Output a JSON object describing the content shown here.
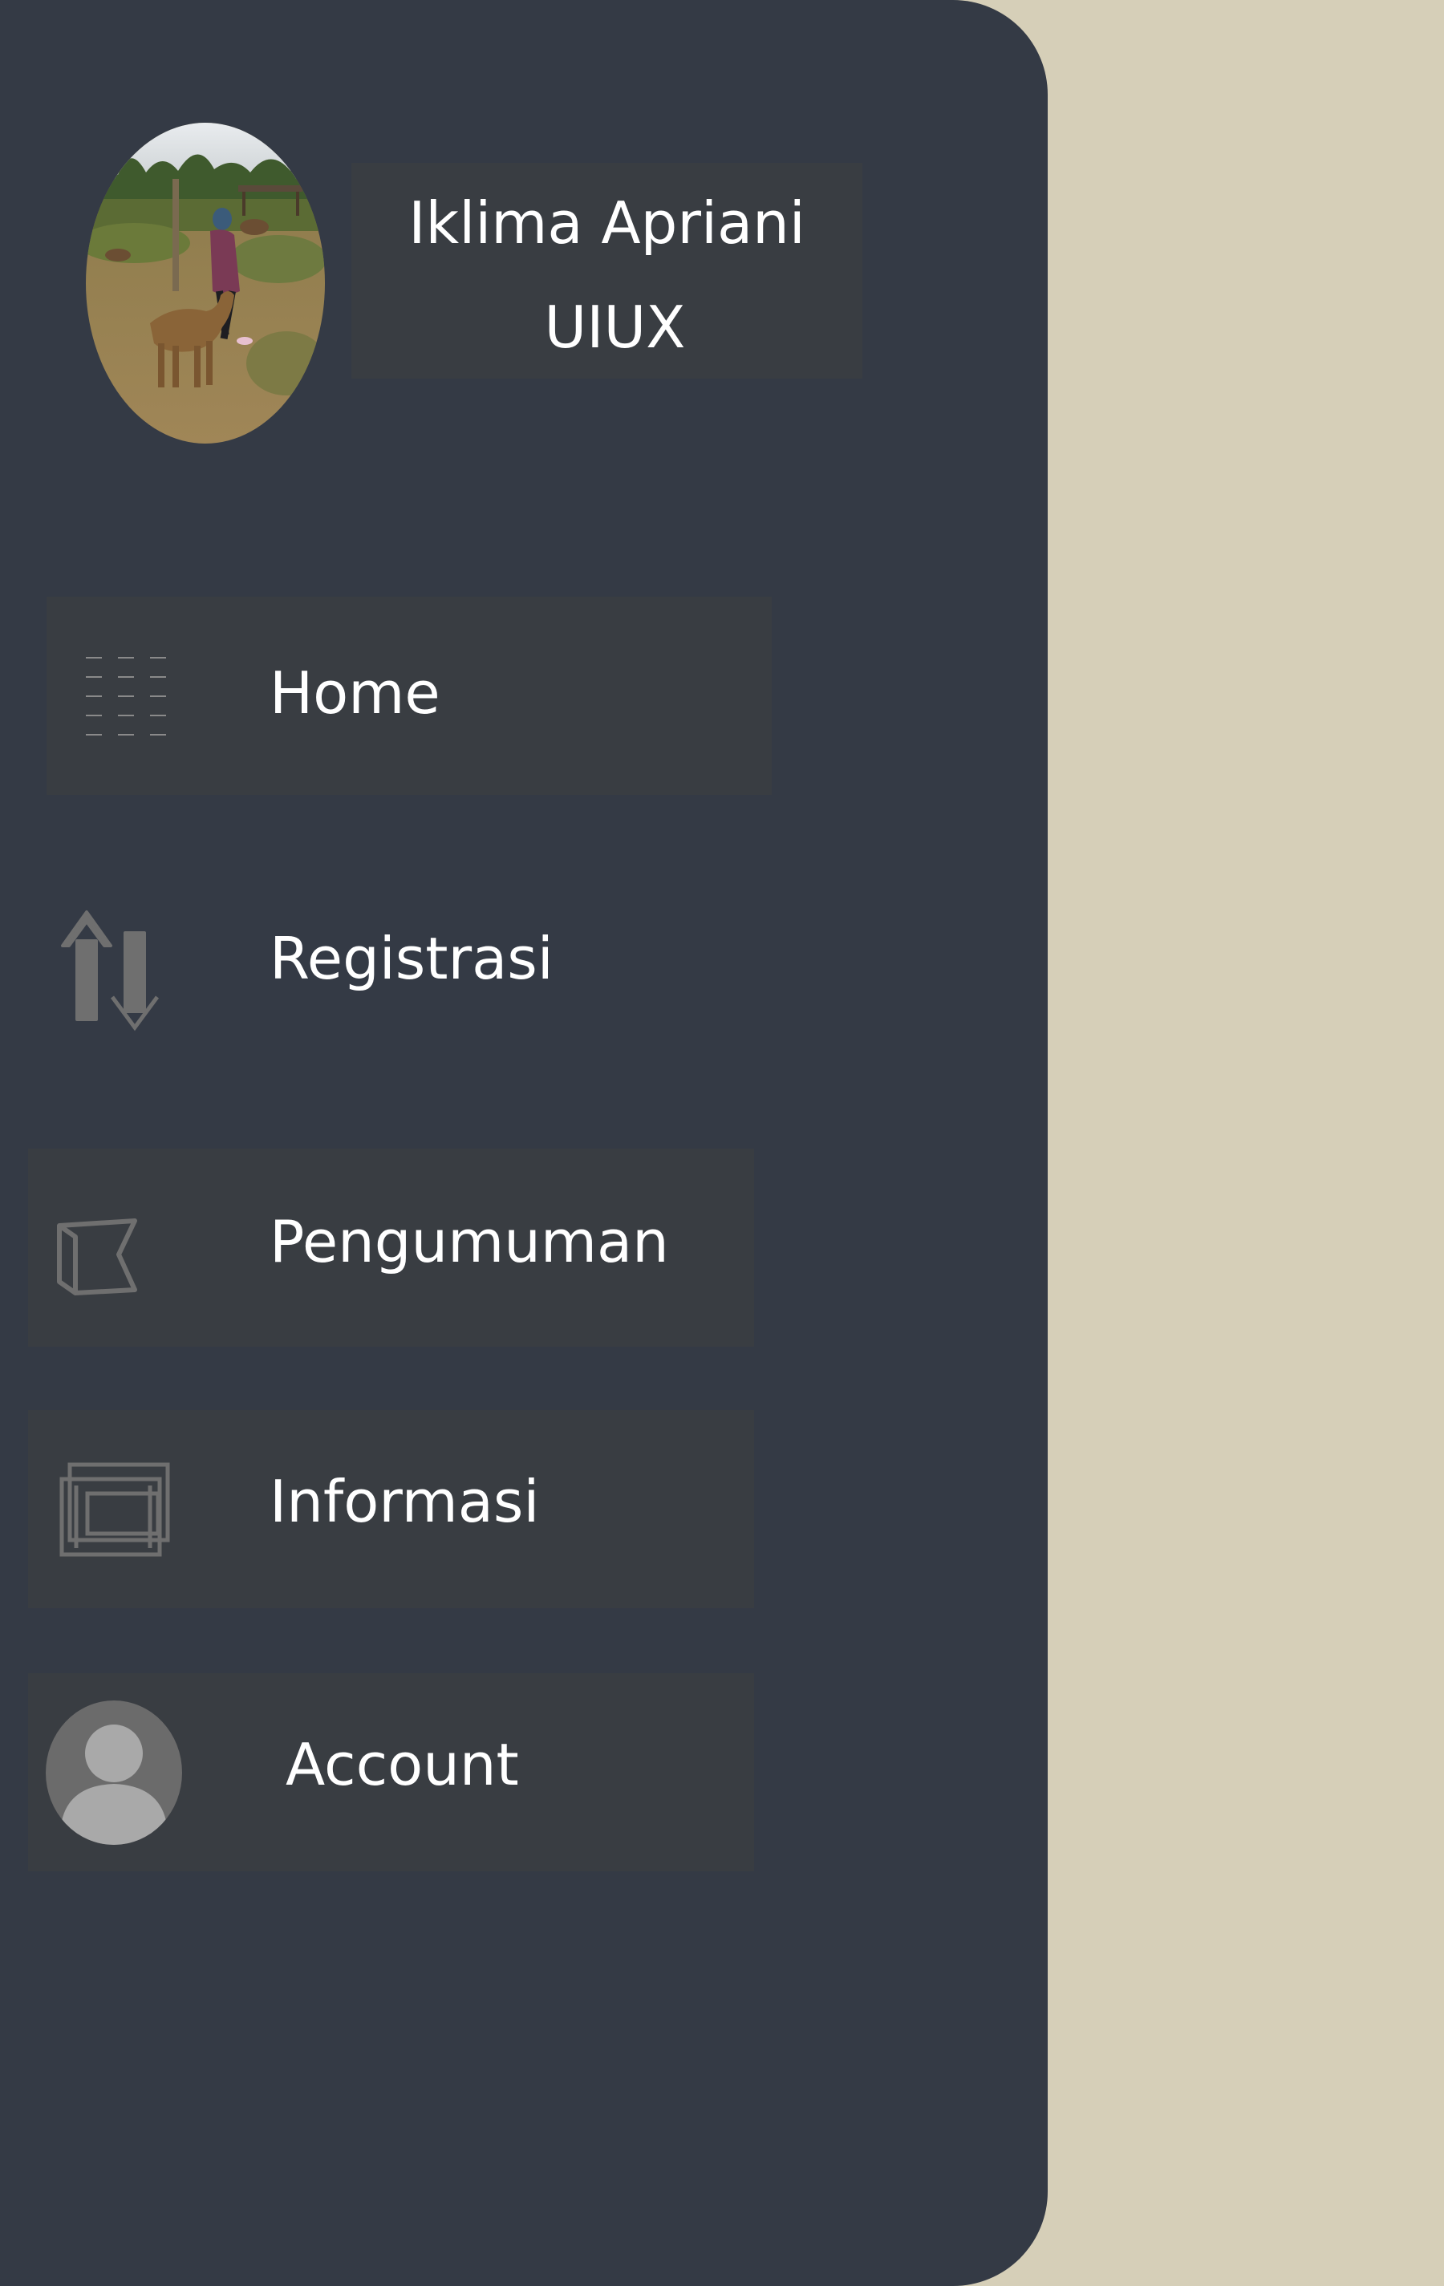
{
  "colors": {
    "page_background": "#d6cfb8",
    "drawer_background": "#343a45",
    "card_background": "#393d42",
    "text": "#ffffff",
    "icon": "#6b6b6b"
  },
  "profile": {
    "name": "Iklima Apriani",
    "role": "UIUX",
    "photo_icon": "profile-photo"
  },
  "menu": {
    "items": [
      {
        "label": "Home",
        "icon": "grid-dashes-icon"
      },
      {
        "label": "Registrasi",
        "icon": "up-down-arrows-icon"
      },
      {
        "label": "Pengumuman",
        "icon": "flag-icon"
      },
      {
        "label": "Informasi",
        "icon": "stacked-frames-icon"
      },
      {
        "label": "Account",
        "icon": "user-avatar-icon"
      }
    ]
  }
}
